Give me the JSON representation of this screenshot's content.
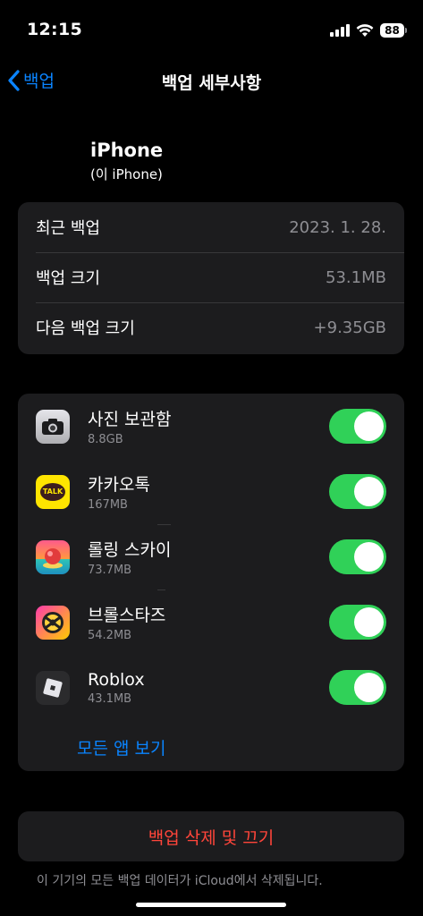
{
  "status_bar": {
    "time": "12:15",
    "battery": "88"
  },
  "nav": {
    "back_label": "백업",
    "title": "백업 세부사항"
  },
  "device": {
    "name": "iPhone",
    "subtitle": "(이 iPhone)"
  },
  "backup_info": [
    {
      "label": "최근 백업",
      "value": "2023. 1. 28."
    },
    {
      "label": "백업 크기",
      "value": "53.1MB"
    },
    {
      "label": "다음 백업 크기",
      "value": "+9.35GB"
    }
  ],
  "apps": [
    {
      "name": "사진 보관함",
      "size": "8.8GB",
      "icon": "camera-icon",
      "enabled": true
    },
    {
      "name": "카카오톡",
      "size": "167MB",
      "icon": "kakaotalk-icon",
      "enabled": true
    },
    {
      "name": "롤링 스카이",
      "size": "73.7MB",
      "icon": "rolling-sky-icon",
      "enabled": true
    },
    {
      "name": "브롤스타즈",
      "size": "54.2MB",
      "icon": "brawl-stars-icon",
      "enabled": true
    },
    {
      "name": "Roblox",
      "size": "43.1MB",
      "icon": "roblox-icon",
      "enabled": true
    }
  ],
  "see_all_label": "모든 앱 보기",
  "delete_label": "백업 삭제 및 끄기",
  "footnote": "이 기기의 모든 백업 데이터가 iCloud에서 삭제됩니다.",
  "kakao_icon_text": "TALK",
  "colors": {
    "accent": "#0a84ff",
    "toggle_on": "#30d158",
    "destructive": "#ff453a",
    "cell": "#1c1c1e"
  }
}
